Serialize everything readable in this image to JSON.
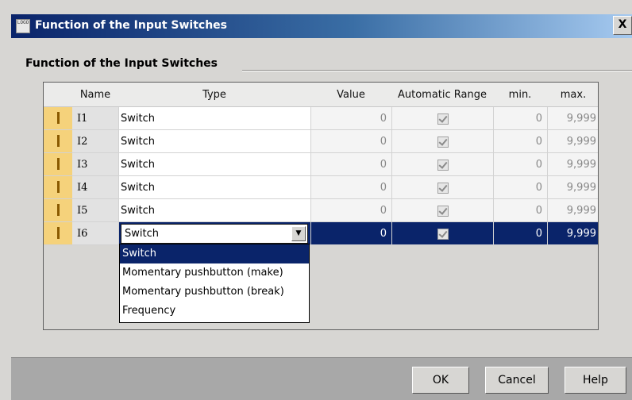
{
  "window": {
    "title": "Function of the Input Switches",
    "icon_text": "LOGO",
    "close_glyph": "X"
  },
  "group": {
    "title": "Function of the Input Switches"
  },
  "table": {
    "columns": [
      "Name",
      "Type",
      "Value",
      "Automatic Range",
      "min.",
      "max."
    ],
    "rows": [
      {
        "name": "I1",
        "type": "Switch",
        "value": "0",
        "auto_range": true,
        "min": "0",
        "max": "9,999"
      },
      {
        "name": "I2",
        "type": "Switch",
        "value": "0",
        "auto_range": true,
        "min": "0",
        "max": "9,999"
      },
      {
        "name": "I3",
        "type": "Switch",
        "value": "0",
        "auto_range": true,
        "min": "0",
        "max": "9,999"
      },
      {
        "name": "I4",
        "type": "Switch",
        "value": "0",
        "auto_range": true,
        "min": "0",
        "max": "9,999"
      },
      {
        "name": "I5",
        "type": "Switch",
        "value": "0",
        "auto_range": true,
        "min": "0",
        "max": "9,999"
      },
      {
        "name": "I6",
        "type": "Switch",
        "value": "0",
        "auto_range": true,
        "min": "0",
        "max": "9,999",
        "selected": true
      }
    ]
  },
  "type_dropdown": {
    "selected": "Switch",
    "options": [
      "Switch",
      "Momentary pushbutton (make)",
      "Momentary pushbutton (break)",
      "Frequency"
    ]
  },
  "buttons": {
    "ok": "OK",
    "cancel": "Cancel",
    "help": "Help"
  },
  "colors": {
    "title_bar": "#0a246a",
    "selection": "#0a246a",
    "row_marker": "#f5d27b",
    "dialog_bg": "#d7d6d3"
  }
}
